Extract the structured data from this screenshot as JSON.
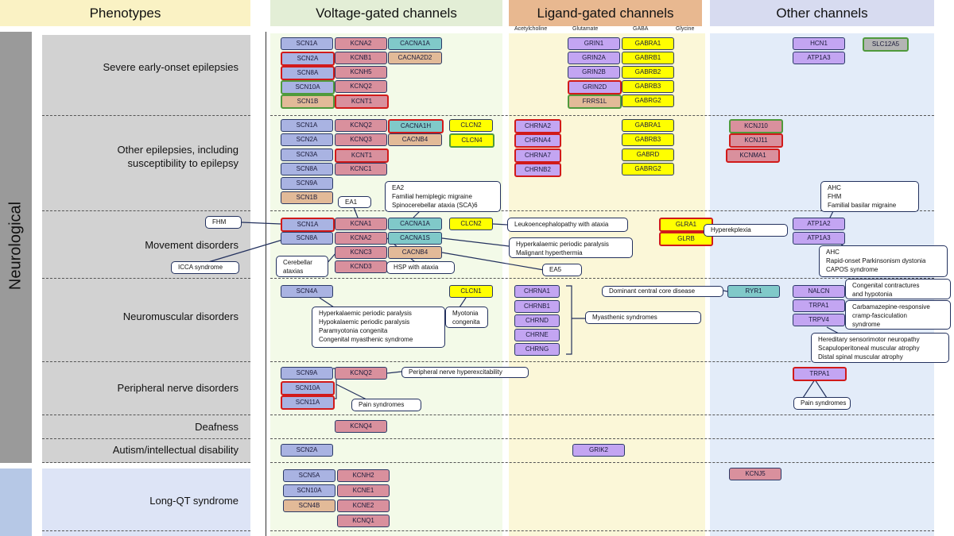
{
  "headers": {
    "phenotypes": "Phenotypes",
    "voltage": "Voltage-gated channels",
    "ligand": "Ligand-gated channels",
    "other": "Other channels"
  },
  "ligand_subheaders": [
    "Acetylcholine",
    "Glutamate",
    "GABA",
    "Glycine"
  ],
  "categories": {
    "neurological": "Neurological"
  },
  "colors": {
    "header_phenotypes": "#faf2c4",
    "header_voltage": "#e3eed6",
    "header_ligand": "#e8b890",
    "header_other": "#d7dbf0",
    "bg_voltage": "#f3fae8",
    "bg_ligand": "#fbf7d8",
    "bg_other": "#e3ecf9",
    "neuro_bar": "#9a9a9a",
    "neuro_block": "#d2d2d2",
    "cardiac_bar": "#b6c8e6",
    "cardiac_block": "#dde4f6",
    "family": {
      "nav": "#a9b3e2",
      "kv": "#d9909d",
      "cav": "#80c9c9",
      "aux": "#e2ba98",
      "cl": "#ffff00",
      "gaba": "#ffff00",
      "lig": "#c3a5f2",
      "grey": "#b4b4b4"
    },
    "border": {
      "default": "#2b3a67",
      "red": "#d11a1a",
      "green": "#4f9a3c"
    }
  },
  "rows": [
    {
      "phenotype": [
        "Severe early-onset epilepsies"
      ],
      "genes": [
        {
          "name": "SCN1A",
          "family": "nav",
          "border": "default"
        },
        {
          "name": "SCN2A",
          "family": "nav",
          "border": "red"
        },
        {
          "name": "SCN8A",
          "family": "nav",
          "border": "red"
        },
        {
          "name": "SCN10A",
          "family": "nav",
          "border": "green"
        },
        {
          "name": "SCN1B",
          "family": "aux",
          "border": "green"
        },
        {
          "name": "KCNA2",
          "family": "kv",
          "border": "default"
        },
        {
          "name": "KCNB1",
          "family": "kv",
          "border": "default"
        },
        {
          "name": "KCNH5",
          "family": "kv",
          "border": "default"
        },
        {
          "name": "KCNQ2",
          "family": "kv",
          "border": "default"
        },
        {
          "name": "KCNT1",
          "family": "kv",
          "border": "red"
        },
        {
          "name": "CACNA1A",
          "family": "cav",
          "border": "default"
        },
        {
          "name": "CACNA2D2",
          "family": "aux",
          "border": "default"
        },
        {
          "name": "GRIN1",
          "family": "lig",
          "border": "default"
        },
        {
          "name": "GRIN2A",
          "family": "lig",
          "border": "default"
        },
        {
          "name": "GRIN2B",
          "family": "lig",
          "border": "default"
        },
        {
          "name": "GRIN2D",
          "family": "lig",
          "border": "red"
        },
        {
          "name": "FRRS1L",
          "family": "aux",
          "border": "green"
        },
        {
          "name": "GABRA1",
          "family": "gaba",
          "border": "default"
        },
        {
          "name": "GABRB1",
          "family": "gaba",
          "border": "default"
        },
        {
          "name": "GABRB2",
          "family": "gaba",
          "border": "default"
        },
        {
          "name": "GABRB3",
          "family": "gaba",
          "border": "default"
        },
        {
          "name": "GABRG2",
          "family": "gaba",
          "border": "default"
        },
        {
          "name": "HCN1",
          "family": "lig",
          "border": "default"
        },
        {
          "name": "ATP1A3",
          "family": "lig",
          "border": "default"
        },
        {
          "name": "SLC12A5",
          "family": "grey",
          "border": "green"
        }
      ],
      "notes": []
    },
    {
      "phenotype": [
        "Other epilepsies, including",
        "susceptibility to epilepsy"
      ],
      "genes": [
        {
          "name": "SCN1A",
          "family": "nav",
          "border": "default"
        },
        {
          "name": "SCN2A",
          "family": "nav",
          "border": "default"
        },
        {
          "name": "SCN3A",
          "family": "nav",
          "border": "default"
        },
        {
          "name": "SCN8A",
          "family": "nav",
          "border": "default"
        },
        {
          "name": "SCN9A",
          "family": "nav",
          "border": "default"
        },
        {
          "name": "SCN1B",
          "family": "aux",
          "border": "default"
        },
        {
          "name": "KCNQ2",
          "family": "kv",
          "border": "default"
        },
        {
          "name": "KCNQ3",
          "family": "kv",
          "border": "default"
        },
        {
          "name": "KCNT1",
          "family": "kv",
          "border": "red"
        },
        {
          "name": "KCNC1",
          "family": "kv",
          "border": "default"
        },
        {
          "name": "CACNA1H",
          "family": "cav",
          "border": "red"
        },
        {
          "name": "CACNB4",
          "family": "aux",
          "border": "default"
        },
        {
          "name": "CLCN2",
          "family": "cl",
          "border": "default"
        },
        {
          "name": "CLCN4",
          "family": "cl",
          "border": "green"
        },
        {
          "name": "CHRNA2",
          "family": "lig",
          "border": "red"
        },
        {
          "name": "CHRNA4",
          "family": "lig",
          "border": "red"
        },
        {
          "name": "CHRNA7",
          "family": "lig",
          "border": "red"
        },
        {
          "name": "CHRNB2",
          "family": "lig",
          "border": "red"
        },
        {
          "name": "GABRA1",
          "family": "gaba",
          "border": "default"
        },
        {
          "name": "GABRB3",
          "family": "gaba",
          "border": "default"
        },
        {
          "name": "GABRD",
          "family": "gaba",
          "border": "default"
        },
        {
          "name": "GABRG2",
          "family": "gaba",
          "border": "default"
        },
        {
          "name": "KCNJ10",
          "family": "kv",
          "border": "green"
        },
        {
          "name": "KCNJ11",
          "family": "kv",
          "border": "red"
        },
        {
          "name": "KCNMA1",
          "family": "kv",
          "border": "red"
        }
      ],
      "notes": []
    },
    {
      "phenotype": [
        "Movement disorders"
      ],
      "genes": [
        {
          "name": "SCN1A",
          "family": "nav",
          "border": "red"
        },
        {
          "name": "SCN8A",
          "family": "nav",
          "border": "default"
        },
        {
          "name": "KCNA1",
          "family": "kv",
          "border": "default"
        },
        {
          "name": "KCNA2",
          "family": "kv",
          "border": "default"
        },
        {
          "name": "KCNC3",
          "family": "kv",
          "border": "default"
        },
        {
          "name": "KCND3",
          "family": "kv",
          "border": "default"
        },
        {
          "name": "CACNA1A",
          "family": "cav",
          "border": "default"
        },
        {
          "name": "CACNA1S",
          "family": "cav",
          "border": "default"
        },
        {
          "name": "CACNB4",
          "family": "aux",
          "border": "default"
        },
        {
          "name": "CLCN2",
          "family": "cl",
          "border": "default"
        },
        {
          "name": "GLRA1",
          "family": "gaba",
          "border": "red"
        },
        {
          "name": "GLRB",
          "family": "gaba",
          "border": "red"
        },
        {
          "name": "ATP1A2",
          "family": "lig",
          "border": "default"
        },
        {
          "name": "ATP1A3",
          "family": "lig",
          "border": "default"
        }
      ],
      "notes": [
        [
          "EA1"
        ],
        [
          "EA2",
          "Familial hemiplegic migraine",
          "Spinocerebellar  ataxia (SCA)6"
        ],
        [
          "AHC",
          "FHM",
          "Familial basilar migraine"
        ],
        [
          "FHM"
        ],
        [
          "ICCA syndrome"
        ],
        [
          "Leukoencephalopathy with ataxia"
        ],
        [
          "Hyperkalaemic periodic paralysis",
          "Malignant hyperthermia"
        ],
        [
          "EA5"
        ],
        [
          "Cerebellar",
          "ataxias"
        ],
        [
          "HSP with ataxia"
        ],
        [
          "Hyperekplexia"
        ],
        [
          "AHC",
          "Rapid-onset Parkinsonism dystonia",
          "CAPOS syndrome"
        ]
      ]
    },
    {
      "phenotype": [
        "Neuromuscular disorders"
      ],
      "genes": [
        {
          "name": "SCN4A",
          "family": "nav",
          "border": "default"
        },
        {
          "name": "CLCN1",
          "family": "cl",
          "border": "default"
        },
        {
          "name": "CHRNA1",
          "family": "lig",
          "border": "default"
        },
        {
          "name": "CHRNB1",
          "family": "lig",
          "border": "default"
        },
        {
          "name": "CHRND",
          "family": "lig",
          "border": "default"
        },
        {
          "name": "CHRNE",
          "family": "lig",
          "border": "default"
        },
        {
          "name": "CHRNG",
          "family": "lig",
          "border": "default"
        },
        {
          "name": "RYR1",
          "family": "cav",
          "border": "default"
        },
        {
          "name": "NALCN",
          "family": "lig",
          "border": "default"
        },
        {
          "name": "TRPA1",
          "family": "lig",
          "border": "default"
        },
        {
          "name": "TRPV4",
          "family": "lig",
          "border": "default"
        }
      ],
      "notes": [
        [
          "Hyperkalaemic periodic paralysis",
          "Hypokalaemic periodic paralysis",
          "Paramyotonia congenita",
          "Congenital myasthenic syndrome"
        ],
        [
          "Myotonia",
          "congenita"
        ],
        [
          "Dominant central core disease"
        ],
        [
          "Myasthenic syndromes"
        ],
        [
          "Congenital contractures",
          "and hypotonia"
        ],
        [
          "Carbamazepine-responsive",
          "cramp-fasciculation",
          "syndrome"
        ],
        [
          "Hereditary sensorimotor  neuropathy",
          "Scapuloperitoneal  muscular atrophy",
          "Distal spinal muscular atrophy"
        ]
      ]
    },
    {
      "phenotype": [
        "Peripheral nerve disorders"
      ],
      "genes": [
        {
          "name": "SCN9A",
          "family": "nav",
          "border": "default"
        },
        {
          "name": "SCN10A",
          "family": "nav",
          "border": "red"
        },
        {
          "name": "SCN11A",
          "family": "nav",
          "border": "red"
        },
        {
          "name": "KCNQ2",
          "family": "kv",
          "border": "default"
        },
        {
          "name": "TRPA1",
          "family": "lig",
          "border": "red"
        }
      ],
      "notes": [
        [
          "Peripheral nerve hyperexcitability"
        ],
        [
          "Pain syndromes"
        ],
        [
          "Pain syndromes"
        ]
      ]
    },
    {
      "phenotype": [
        "Deafness"
      ],
      "genes": [
        {
          "name": "KCNQ4",
          "family": "kv",
          "border": "default"
        }
      ],
      "notes": []
    },
    {
      "phenotype": [
        "Autism/intellectual disability"
      ],
      "genes": [
        {
          "name": "SCN2A",
          "family": "nav",
          "border": "default"
        },
        {
          "name": "GRIK2",
          "family": "lig",
          "border": "default"
        }
      ],
      "notes": []
    },
    {
      "phenotype": [
        "Long-QT syndrome"
      ],
      "genes": [
        {
          "name": "SCN5A",
          "family": "nav",
          "border": "default"
        },
        {
          "name": "SCN10A",
          "family": "nav",
          "border": "default"
        },
        {
          "name": "SCN4B",
          "family": "aux",
          "border": "default"
        },
        {
          "name": "KCNH2",
          "family": "kv",
          "border": "default"
        },
        {
          "name": "KCNE1",
          "family": "kv",
          "border": "default"
        },
        {
          "name": "KCNE2",
          "family": "kv",
          "border": "default"
        },
        {
          "name": "KCNQ1",
          "family": "kv",
          "border": "default"
        },
        {
          "name": "KCNJ5",
          "family": "kv",
          "border": "default"
        }
      ],
      "notes": []
    }
  ]
}
